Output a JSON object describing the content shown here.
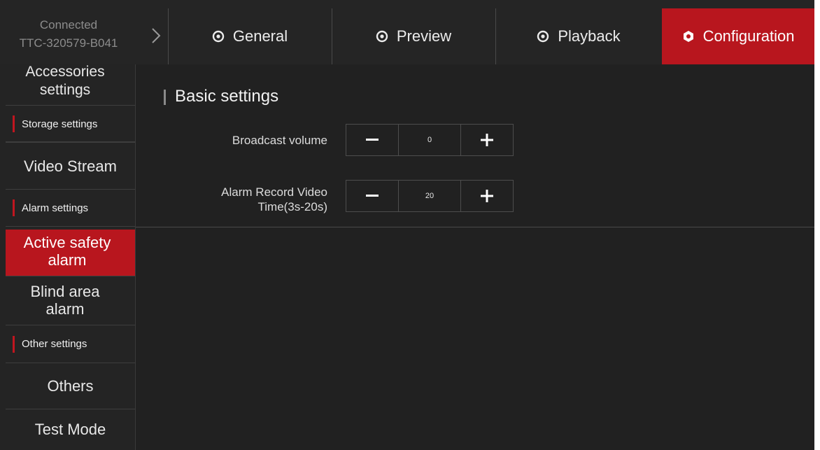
{
  "connection": {
    "status": "Connected",
    "device_id": "TTC-320579-B041"
  },
  "tabs": [
    {
      "label": "General",
      "icon": "target-icon"
    },
    {
      "label": "Preview",
      "icon": "target-icon"
    },
    {
      "label": "Playback",
      "icon": "target-icon"
    },
    {
      "label": "Configuration",
      "icon": "gear-icon",
      "active": true
    }
  ],
  "sidebar": {
    "items": [
      {
        "label": "Accessories settings",
        "type": "item"
      },
      {
        "label": "Storage settings",
        "type": "group"
      },
      {
        "label": "Video Stream",
        "type": "item"
      },
      {
        "label": "Alarm settings",
        "type": "group"
      },
      {
        "label": "Active safety alarm",
        "type": "item",
        "active": true
      },
      {
        "label": "Blind area alarm",
        "type": "item"
      },
      {
        "label": "Other settings",
        "type": "group"
      },
      {
        "label": "Others",
        "type": "item"
      },
      {
        "label": "Test Mode",
        "type": "item"
      }
    ]
  },
  "main": {
    "section_title": "Basic settings",
    "fields": [
      {
        "label": "Broadcast volume",
        "value": "0",
        "minus": "−",
        "plus": "+"
      },
      {
        "label_line1": "Alarm Record Video",
        "label_line2": "Time(3s-20s)",
        "value": "20",
        "minus": "−",
        "plus": "+"
      }
    ]
  },
  "colors": {
    "accent": "#b8161e",
    "background": "#212121",
    "panel": "#252525"
  }
}
